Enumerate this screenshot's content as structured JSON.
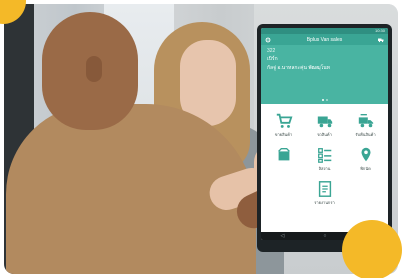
{
  "colors": {
    "primary": "#3aa594",
    "hero": "#49b4a2",
    "accent_yellow": "#f4b928"
  },
  "app": {
    "status_time": "10:30",
    "title": "Bplus Van sales",
    "left_icon": "gear-icon",
    "right_icon": "truck-icon"
  },
  "hero": {
    "code": "322",
    "line1": "เบิร์ก",
    "line2": "กัลจู่ อ.นาหลกะคุ่น พัฒฒุโนท"
  },
  "menu": [
    {
      "label": "ขายสินค้า",
      "icon": "cart-icon"
    },
    {
      "label": "รถสินค้า",
      "icon": "truck-icon"
    },
    {
      "label": "รับคืนสินค้า",
      "icon": "return-truck-icon"
    },
    {
      "label": "",
      "icon": "box-icon"
    },
    {
      "label": "ลิสงาน",
      "icon": "checklist-icon"
    },
    {
      "label": "พิกนัด",
      "icon": "location-pin-icon"
    },
    {
      "label": "",
      "icon": ""
    },
    {
      "label": "รายงานกรา",
      "icon": "report-icon"
    },
    {
      "label": "",
      "icon": ""
    }
  ],
  "navbar": {
    "back": "◁",
    "home": "○",
    "recent": "□"
  }
}
